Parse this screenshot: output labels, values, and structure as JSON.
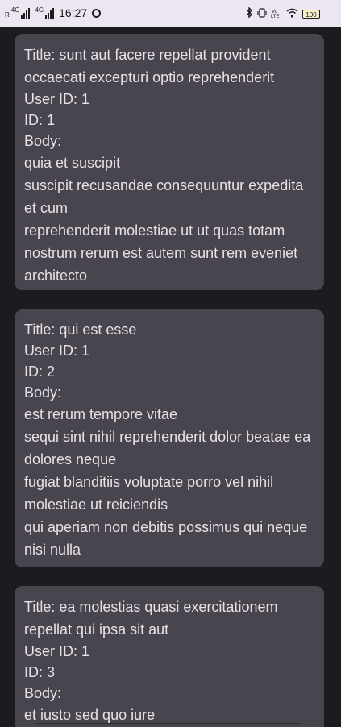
{
  "status_bar": {
    "sim1_tag": "4G",
    "sim1_prefix": "R",
    "sim2_tag": "4G",
    "time": "16:27",
    "volte_tag": "Vo\nLTE",
    "battery": "100"
  },
  "posts": [
    {
      "title": "Title: sunt aut facere repellat provident occaecati excepturi optio reprehenderit",
      "user_id": "User ID: 1",
      "id": "ID: 1",
      "body_label": "Body:",
      "body_lines": [
        "quia et suscipit",
        "suscipit recusandae consequuntur expedita et cum",
        "reprehenderit molestiae ut ut quas totam nostrum rerum est autem sunt rem eveniet architecto"
      ]
    },
    {
      "title": "Title: qui est esse",
      "user_id": "User ID: 1",
      "id": "ID: 2",
      "body_label": "Body:",
      "body_lines": [
        "est rerum tempore vitae",
        "sequi sint nihil reprehenderit dolor beatae ea dolores neque",
        "fugiat blanditiis voluptate porro vel nihil molestiae ut reiciendis",
        "qui aperiam non debitis possimus qui neque nisi nulla"
      ]
    },
    {
      "title": "Title: ea molestias quasi exercitationem repellat qui ipsa sit aut",
      "user_id": "User ID: 1",
      "id": "ID: 3",
      "body_label": "Body:",
      "body_lines": [
        "et iusto sed quo iure"
      ]
    }
  ]
}
